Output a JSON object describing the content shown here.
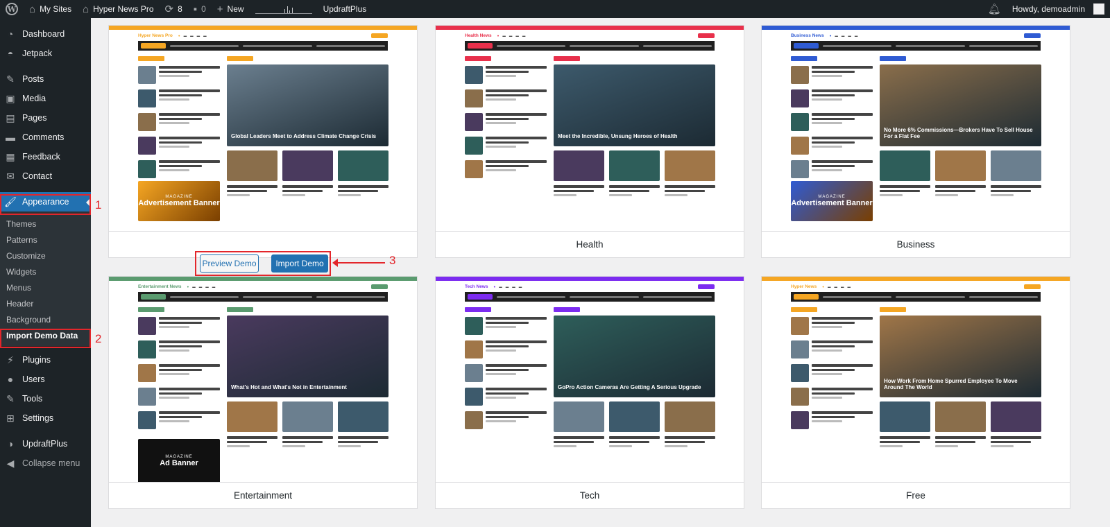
{
  "adminbar": {
    "my_sites": "My Sites",
    "site_name": "Hyper News Pro",
    "updates_count": "8",
    "comments_count": "0",
    "new_label": "New",
    "updraft": "UpdraftPlus",
    "howdy": "Howdy, demoadmin"
  },
  "sidebar": {
    "dashboard": "Dashboard",
    "jetpack": "Jetpack",
    "posts": "Posts",
    "media": "Media",
    "pages": "Pages",
    "comments": "Comments",
    "feedback": "Feedback",
    "contact": "Contact",
    "appearance": "Appearance",
    "submenu": [
      "Themes",
      "Patterns",
      "Customize",
      "Widgets",
      "Menus",
      "Header",
      "Background",
      "Import Demo Data"
    ],
    "plugins": "Plugins",
    "users": "Users",
    "tools": "Tools",
    "settings": "Settings",
    "updraftplus": "UpdraftPlus",
    "collapse": "Collapse menu"
  },
  "annotations": {
    "step1": "1",
    "step2": "2",
    "step3": "3"
  },
  "demos": [
    {
      "name": "",
      "logo": "Hyper News Pro",
      "accent": "#f5a623",
      "headline": "Global Leaders Meet to Address Climate Change Crisis",
      "banner": "Advertisement Banner",
      "banner_small": "MAGAZINE"
    },
    {
      "name": "Health",
      "logo": "Health News",
      "accent": "#e8304b",
      "headline": "Meet the Incredible, Unsung Heroes of Health"
    },
    {
      "name": "Business",
      "logo": "Business News",
      "accent": "#2f5bd3",
      "headline": "No More 6% Commissions—Brokers Have To Sell House For a Flat Fee",
      "banner": "Advertisement Banner",
      "banner_small": "MAGAZINE"
    },
    {
      "name": "Entertainment",
      "logo": "Entertainment News",
      "accent": "#5a9b6f",
      "headline": "What's Hot and What's Not in Entertainment",
      "banner": "Ad Banner",
      "banner_small": "MAGAZINE"
    },
    {
      "name": "Tech",
      "logo": "Tech News",
      "accent": "#7c2cf0",
      "headline": "GoPro Action Cameras Are Getting A Serious Upgrade"
    },
    {
      "name": "Free",
      "logo": "Hyper News",
      "accent": "#f5a623",
      "headline": "How Work From Home Spurred Employee To Move Around The World"
    }
  ],
  "buttons": {
    "preview": "Preview Demo",
    "import": "Import Demo"
  },
  "colors": {
    "wp_blue": "#2271b1",
    "highlight_red": "#e3262b",
    "admin_dark": "#1d2327"
  }
}
